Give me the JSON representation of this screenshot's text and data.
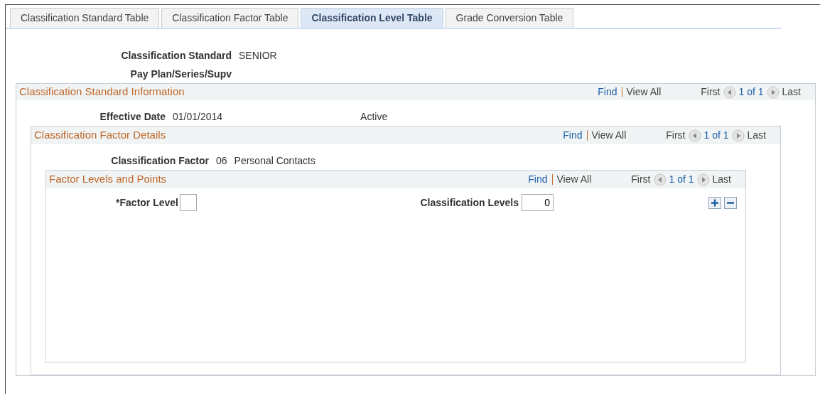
{
  "tabs": [
    {
      "label": "Classification Standard Table",
      "selected": false
    },
    {
      "label": "Classification Factor Table",
      "selected": false
    },
    {
      "label": "Classification Level Table",
      "selected": true
    },
    {
      "label": "Grade Conversion Table",
      "selected": false
    }
  ],
  "fields": [
    {
      "label": "Classification Standard",
      "values": [
        "SENIOR"
      ]
    },
    {
      "label": "Pay Plan/Series/Supv"
    }
  ],
  "section": {
    "title": "Classification Standard Information",
    "nav": {
      "find": "Find",
      "view_all": "View All",
      "first": "First",
      "counter": "1 of 1",
      "last": "Last"
    },
    "fields": [
      {
        "label": "Effective Date",
        "values": [
          "01/01/2014"
        ],
        "status": "Active"
      }
    ],
    "section": {
      "title": "Classification Factor Details",
      "nav": {
        "find": "Find",
        "view_all": "View All",
        "first": "First",
        "counter": "1 of 1",
        "last": "Last"
      },
      "fields": [
        {
          "label": "Classification Factor",
          "values": [
            "06",
            "Personal Contacts"
          ]
        }
      ],
      "section": {
        "title": "Factor Levels and Points",
        "nav": {
          "find": "Find",
          "view_all": "View All",
          "first": "First",
          "counter": "1 of 1",
          "last": "Last"
        },
        "inputs": [
          {
            "label": "*Factor Level"
          },
          {
            "label": "Classification Levels",
            "value": "0"
          }
        ]
      }
    }
  }
}
